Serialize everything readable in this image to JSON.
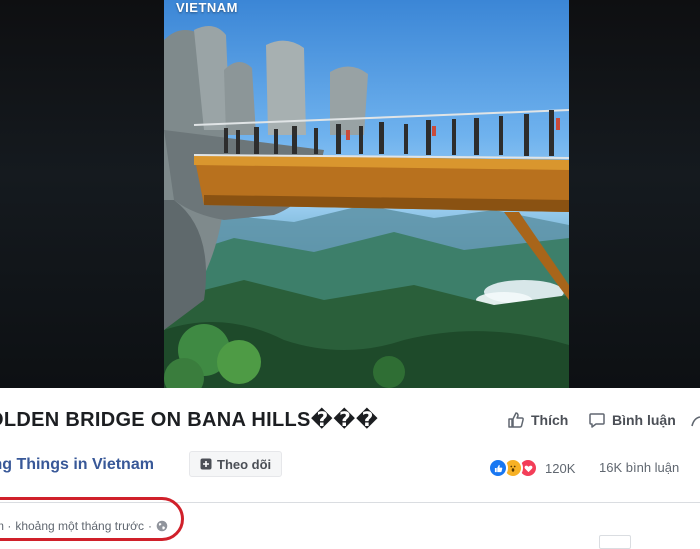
{
  "video": {
    "brand": "VIETNAM"
  },
  "post": {
    "title": "OLDEN BRIDGE ON BANA HILLS���",
    "page_name": "ing Things in Vietnam",
    "follow_label": "Theo dõi",
    "like_label": "Thích",
    "comment_label": "Bình luận",
    "reaction_count": "120K",
    "comment_count": "16K bình luận",
    "meta_prefix": "m ·",
    "time_ago": "khoảng một tháng trước",
    "meta_sep": "·",
    "reactions": [
      "like",
      "wow",
      "love"
    ],
    "privacy_icon": "globe-icon"
  },
  "colors": {
    "link": "#385898",
    "highlight_outline": "#d0202a",
    "like_reaction": "#1877f2",
    "love_reaction": "#f33e58",
    "wow_reaction": "#f7b125"
  }
}
